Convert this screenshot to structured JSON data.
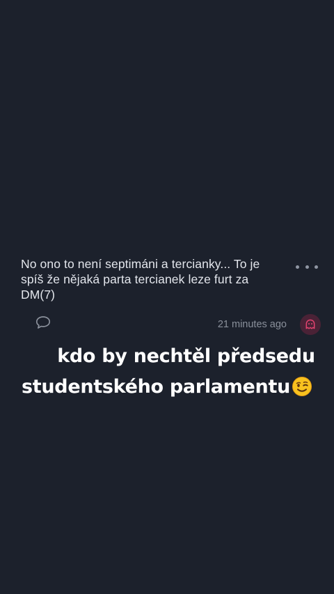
{
  "comment": {
    "text_lines": [
      "No ono to není septimáni a tercianky... To je",
      "spíš že nějaká parta tercianek leze furt za",
      "DM(7)"
    ],
    "timestamp": "21 minutes ago",
    "reply_icon": "speech-bubble-icon",
    "more_icon": "ellipsis-icon",
    "avatar_icon": "ghost-avatar-icon"
  },
  "caption": {
    "line1": "kdo by nechtěl předsedu",
    "line2": "studentského parlamentu",
    "emoji": "winking-face-emoji"
  },
  "colors": {
    "background": "#1c212c",
    "comment_text": "#e3e6ec",
    "muted": "#8a909b",
    "avatar_bg": "#4a2236",
    "avatar_accent": "#e2436f"
  }
}
